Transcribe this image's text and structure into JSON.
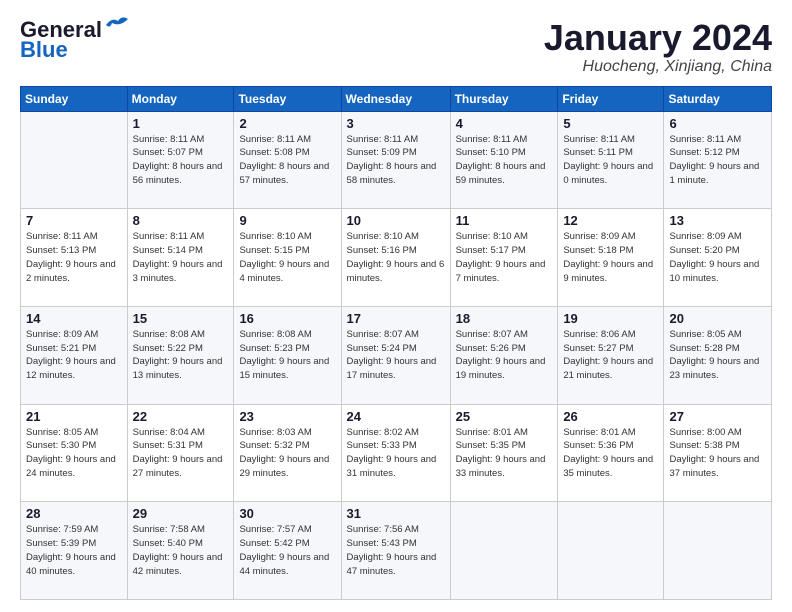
{
  "header": {
    "logo_general": "General",
    "logo_blue": "Blue",
    "month_title": "January 2024",
    "location": "Huocheng, Xinjiang, China"
  },
  "weekdays": [
    "Sunday",
    "Monday",
    "Tuesday",
    "Wednesday",
    "Thursday",
    "Friday",
    "Saturday"
  ],
  "weeks": [
    [
      {
        "day": "",
        "sunrise": "",
        "sunset": "",
        "daylight": ""
      },
      {
        "day": "1",
        "sunrise": "Sunrise: 8:11 AM",
        "sunset": "Sunset: 5:07 PM",
        "daylight": "Daylight: 8 hours and 56 minutes."
      },
      {
        "day": "2",
        "sunrise": "Sunrise: 8:11 AM",
        "sunset": "Sunset: 5:08 PM",
        "daylight": "Daylight: 8 hours and 57 minutes."
      },
      {
        "day": "3",
        "sunrise": "Sunrise: 8:11 AM",
        "sunset": "Sunset: 5:09 PM",
        "daylight": "Daylight: 8 hours and 58 minutes."
      },
      {
        "day": "4",
        "sunrise": "Sunrise: 8:11 AM",
        "sunset": "Sunset: 5:10 PM",
        "daylight": "Daylight: 8 hours and 59 minutes."
      },
      {
        "day": "5",
        "sunrise": "Sunrise: 8:11 AM",
        "sunset": "Sunset: 5:11 PM",
        "daylight": "Daylight: 9 hours and 0 minutes."
      },
      {
        "day": "6",
        "sunrise": "Sunrise: 8:11 AM",
        "sunset": "Sunset: 5:12 PM",
        "daylight": "Daylight: 9 hours and 1 minute."
      }
    ],
    [
      {
        "day": "7",
        "sunrise": "Sunrise: 8:11 AM",
        "sunset": "Sunset: 5:13 PM",
        "daylight": "Daylight: 9 hours and 2 minutes."
      },
      {
        "day": "8",
        "sunrise": "Sunrise: 8:11 AM",
        "sunset": "Sunset: 5:14 PM",
        "daylight": "Daylight: 9 hours and 3 minutes."
      },
      {
        "day": "9",
        "sunrise": "Sunrise: 8:10 AM",
        "sunset": "Sunset: 5:15 PM",
        "daylight": "Daylight: 9 hours and 4 minutes."
      },
      {
        "day": "10",
        "sunrise": "Sunrise: 8:10 AM",
        "sunset": "Sunset: 5:16 PM",
        "daylight": "Daylight: 9 hours and 6 minutes."
      },
      {
        "day": "11",
        "sunrise": "Sunrise: 8:10 AM",
        "sunset": "Sunset: 5:17 PM",
        "daylight": "Daylight: 9 hours and 7 minutes."
      },
      {
        "day": "12",
        "sunrise": "Sunrise: 8:09 AM",
        "sunset": "Sunset: 5:18 PM",
        "daylight": "Daylight: 9 hours and 9 minutes."
      },
      {
        "day": "13",
        "sunrise": "Sunrise: 8:09 AM",
        "sunset": "Sunset: 5:20 PM",
        "daylight": "Daylight: 9 hours and 10 minutes."
      }
    ],
    [
      {
        "day": "14",
        "sunrise": "Sunrise: 8:09 AM",
        "sunset": "Sunset: 5:21 PM",
        "daylight": "Daylight: 9 hours and 12 minutes."
      },
      {
        "day": "15",
        "sunrise": "Sunrise: 8:08 AM",
        "sunset": "Sunset: 5:22 PM",
        "daylight": "Daylight: 9 hours and 13 minutes."
      },
      {
        "day": "16",
        "sunrise": "Sunrise: 8:08 AM",
        "sunset": "Sunset: 5:23 PM",
        "daylight": "Daylight: 9 hours and 15 minutes."
      },
      {
        "day": "17",
        "sunrise": "Sunrise: 8:07 AM",
        "sunset": "Sunset: 5:24 PM",
        "daylight": "Daylight: 9 hours and 17 minutes."
      },
      {
        "day": "18",
        "sunrise": "Sunrise: 8:07 AM",
        "sunset": "Sunset: 5:26 PM",
        "daylight": "Daylight: 9 hours and 19 minutes."
      },
      {
        "day": "19",
        "sunrise": "Sunrise: 8:06 AM",
        "sunset": "Sunset: 5:27 PM",
        "daylight": "Daylight: 9 hours and 21 minutes."
      },
      {
        "day": "20",
        "sunrise": "Sunrise: 8:05 AM",
        "sunset": "Sunset: 5:28 PM",
        "daylight": "Daylight: 9 hours and 23 minutes."
      }
    ],
    [
      {
        "day": "21",
        "sunrise": "Sunrise: 8:05 AM",
        "sunset": "Sunset: 5:30 PM",
        "daylight": "Daylight: 9 hours and 24 minutes."
      },
      {
        "day": "22",
        "sunrise": "Sunrise: 8:04 AM",
        "sunset": "Sunset: 5:31 PM",
        "daylight": "Daylight: 9 hours and 27 minutes."
      },
      {
        "day": "23",
        "sunrise": "Sunrise: 8:03 AM",
        "sunset": "Sunset: 5:32 PM",
        "daylight": "Daylight: 9 hours and 29 minutes."
      },
      {
        "day": "24",
        "sunrise": "Sunrise: 8:02 AM",
        "sunset": "Sunset: 5:33 PM",
        "daylight": "Daylight: 9 hours and 31 minutes."
      },
      {
        "day": "25",
        "sunrise": "Sunrise: 8:01 AM",
        "sunset": "Sunset: 5:35 PM",
        "daylight": "Daylight: 9 hours and 33 minutes."
      },
      {
        "day": "26",
        "sunrise": "Sunrise: 8:01 AM",
        "sunset": "Sunset: 5:36 PM",
        "daylight": "Daylight: 9 hours and 35 minutes."
      },
      {
        "day": "27",
        "sunrise": "Sunrise: 8:00 AM",
        "sunset": "Sunset: 5:38 PM",
        "daylight": "Daylight: 9 hours and 37 minutes."
      }
    ],
    [
      {
        "day": "28",
        "sunrise": "Sunrise: 7:59 AM",
        "sunset": "Sunset: 5:39 PM",
        "daylight": "Daylight: 9 hours and 40 minutes."
      },
      {
        "day": "29",
        "sunrise": "Sunrise: 7:58 AM",
        "sunset": "Sunset: 5:40 PM",
        "daylight": "Daylight: 9 hours and 42 minutes."
      },
      {
        "day": "30",
        "sunrise": "Sunrise: 7:57 AM",
        "sunset": "Sunset: 5:42 PM",
        "daylight": "Daylight: 9 hours and 44 minutes."
      },
      {
        "day": "31",
        "sunrise": "Sunrise: 7:56 AM",
        "sunset": "Sunset: 5:43 PM",
        "daylight": "Daylight: 9 hours and 47 minutes."
      },
      {
        "day": "",
        "sunrise": "",
        "sunset": "",
        "daylight": ""
      },
      {
        "day": "",
        "sunrise": "",
        "sunset": "",
        "daylight": ""
      },
      {
        "day": "",
        "sunrise": "",
        "sunset": "",
        "daylight": ""
      }
    ]
  ]
}
